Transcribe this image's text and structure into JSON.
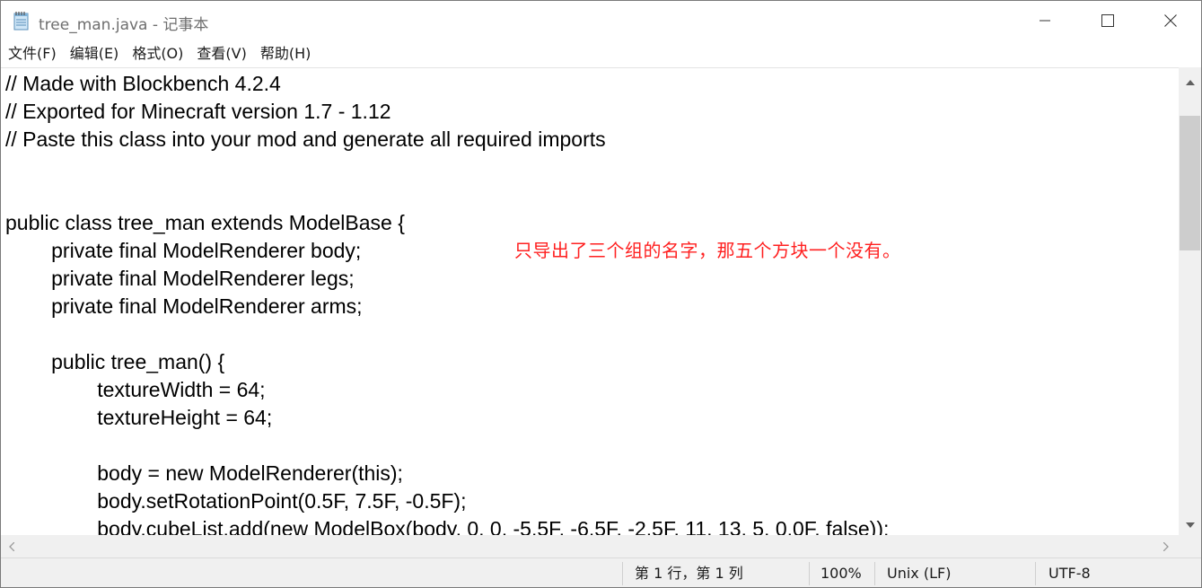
{
  "window": {
    "title": "tree_man.java - 记事本"
  },
  "menu": {
    "items": [
      {
        "label": "文件(F)"
      },
      {
        "label": "编辑(E)"
      },
      {
        "label": "格式(O)"
      },
      {
        "label": "查看(V)"
      },
      {
        "label": "帮助(H)"
      }
    ]
  },
  "editor": {
    "lines": [
      "// Made with Blockbench 4.2.4",
      "// Exported for Minecraft version 1.7 - 1.12",
      "// Paste this class into your mod and generate all required imports",
      "",
      "",
      "public class tree_man extends ModelBase {",
      "\tprivate final ModelRenderer body;",
      "\tprivate final ModelRenderer legs;",
      "\tprivate final ModelRenderer arms;",
      "",
      "\tpublic tree_man() {",
      "\t\ttextureWidth = 64;",
      "\t\ttextureHeight = 64;",
      "",
      "\t\tbody = new ModelRenderer(this);",
      "\t\tbody.setRotationPoint(0.5F, 7.5F, -0.5F);",
      "\t\tbody.cubeList.add(new ModelBox(body, 0, 0, -5.5F, -6.5F, -2.5F, 11, 13, 5, 0.0F, false));"
    ],
    "annotation": "只导出了三个组的名字，那五个方块一个没有。",
    "annotation_color": "#ff2020"
  },
  "status": {
    "position": "第 1 行，第 1 列",
    "zoom": "100%",
    "line_ending": "Unix (LF)",
    "encoding": "UTF-8"
  },
  "icons": {
    "app": "notepad-icon",
    "minimize": "minimize-icon",
    "maximize": "maximize-icon",
    "close": "close-icon"
  }
}
